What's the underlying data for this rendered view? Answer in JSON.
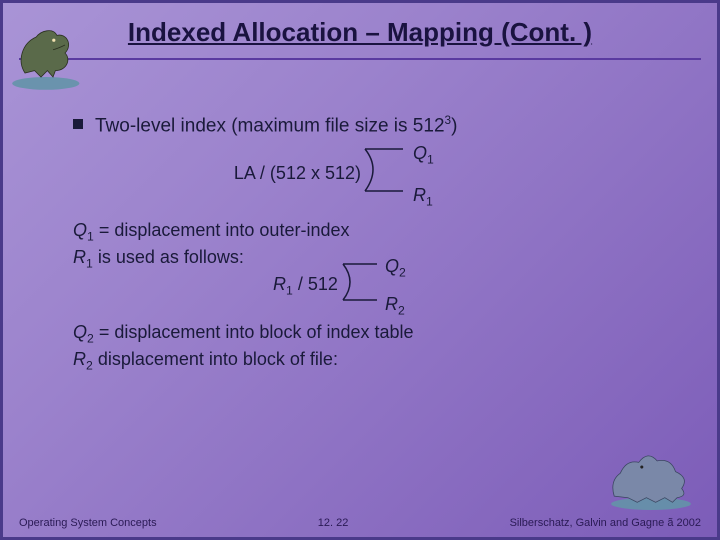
{
  "title": "Indexed Allocation – Mapping (Cont. )",
  "bullet_main": "Two-level index (maximum file size is 512",
  "bullet_sup": "3",
  "bullet_tail": ")",
  "eq1_input": "LA / (512 x 512)",
  "eq1_q": "Q",
  "eq1_q_sub": "1",
  "eq1_r": "R",
  "eq1_r_sub": "1",
  "exp1_q": "Q",
  "exp1_q_sub": "1",
  "exp1_q_text": " = displacement into outer-index",
  "exp1_r": "R",
  "exp1_r_sub": "1",
  "exp1_r_text": " is used as follows:",
  "eq2_input_a": "R",
  "eq2_input_a_sub": "1",
  "eq2_input_b": " / 512",
  "eq2_q": "Q",
  "eq2_q_sub": "2",
  "eq2_r": "R",
  "eq2_r_sub": "2",
  "exp2_q": "Q",
  "exp2_q_sub": "2",
  "exp2_q_text": " = displacement into block of index table",
  "exp2_r": "R",
  "exp2_r_sub": "2",
  "exp2_r_text": " displacement into block of file:",
  "footer_left": "Operating System Concepts",
  "footer_center": "12. 22",
  "footer_right": "Silberschatz, Galvin and  Gagne ã 2002"
}
